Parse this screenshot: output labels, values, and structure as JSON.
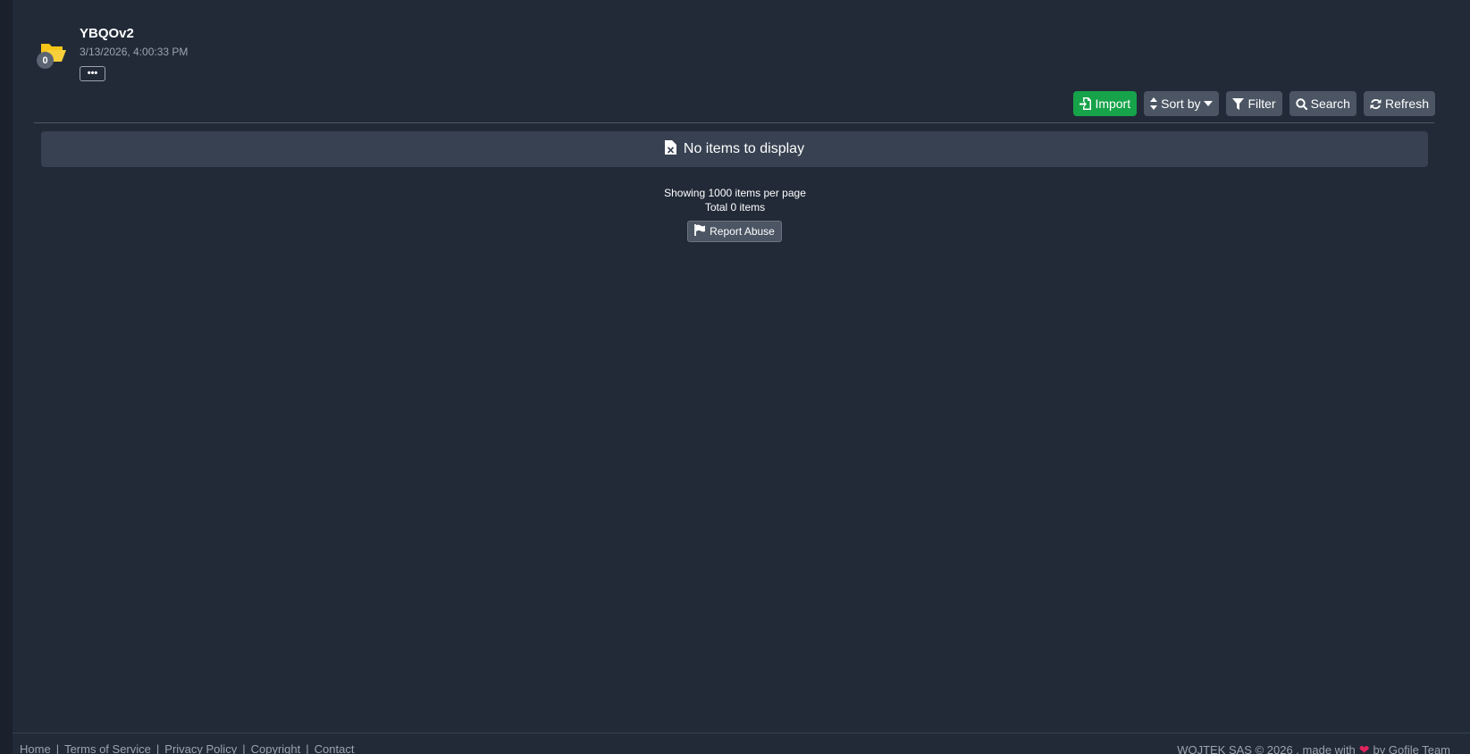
{
  "folder": {
    "title": "YBQOv2",
    "date": "3/13/2026, 4:00:33 PM",
    "item_count": "0",
    "more_label": "•••"
  },
  "toolbar": {
    "import_label": "Import",
    "sort_label": "Sort by",
    "filter_label": "Filter",
    "search_label": "Search",
    "refresh_label": "Refresh"
  },
  "content": {
    "empty_message": "No items to display",
    "per_page_text": "Showing 1000 items per page",
    "total_text": "Total 0 items",
    "report_label": "Report Abuse"
  },
  "footer": {
    "links": [
      "Home",
      "Terms of Service",
      "Privacy Policy",
      "Copyright",
      "Contact"
    ],
    "separator": "|",
    "credit_prefix": "WOJTEK SAS © 2026 , made with",
    "credit_suffix": "by Gofile Team"
  },
  "colors": {
    "background": "#222a38",
    "import_button": "#16a34a",
    "folder_icon": "#f5c518",
    "heart": "#e0245e"
  }
}
